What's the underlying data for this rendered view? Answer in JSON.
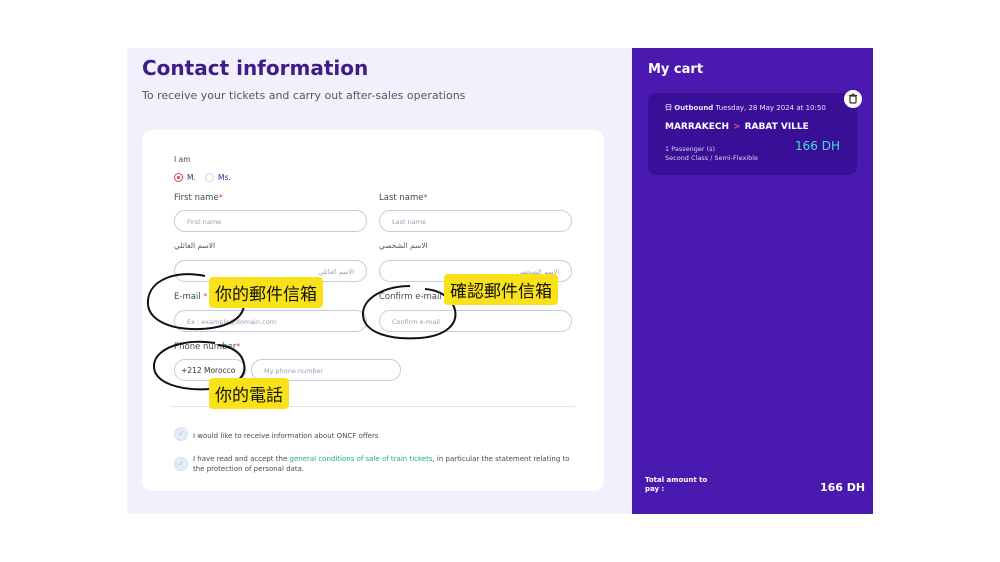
{
  "contact": {
    "title": "Contact information",
    "subtitle": "To receive your tickets and carry out after-sales operations"
  },
  "form": {
    "i_am_label": "I am",
    "gender_options": [
      "M.",
      "Ms."
    ],
    "selected_gender": "M.",
    "first_name": {
      "label": "First name",
      "placeholder": "First name"
    },
    "last_name": {
      "label": "Last name",
      "placeholder": "Last name"
    },
    "first_name_ar": {
      "label": "الاسم العائلي",
      "placeholder": "الاسم العائلي"
    },
    "last_name_ar": {
      "label": "الاسم الشخصي",
      "placeholder": "الاسم الشخصي"
    },
    "email": {
      "label": "E-mail",
      "placeholder": "Ex : example@domain.com"
    },
    "confirm_email": {
      "label": "Confirm e-mail",
      "placeholder": "Confirm e-mail"
    },
    "phone": {
      "label": "Phone number",
      "country": "+212 Morocco",
      "placeholder": "My phone number"
    },
    "required_mark": "*",
    "offers_text": "I would like to receive information about ONCF offers",
    "terms_prefix": "I have read and accept the ",
    "terms_link": "general conditions of sale of train tickets",
    "terms_suffix": ", in particular the statement relating to the protection of personal data."
  },
  "annotations": {
    "email_note": "你的郵件信箱",
    "confirm_email_note": "確認郵件信箱",
    "phone_note": "你的電話"
  },
  "cart": {
    "title": "My cart",
    "direction": "Outbound",
    "date_time": "Tuesday, 28 May 2024 at 10:50",
    "origin": "MARRAKECH",
    "destination": "RABAT VILLE",
    "route_arrow": ">",
    "passengers": "1 Passenger (s)",
    "fare_class": "Second Class / Semi-Flexible",
    "price": "166 DH",
    "total_label": "Total amount to pay :",
    "total_value": "166 DH"
  },
  "colors": {
    "brand_purple": "#3d1d87",
    "cart_purple": "#4a1ab0",
    "accent_pink": "#d94060",
    "price_teal": "#41e0d1",
    "link_green": "#1fae79",
    "note_yellow": "#f9e21a"
  },
  "icons": [
    "train-icon",
    "trash-icon",
    "check-icon"
  ]
}
